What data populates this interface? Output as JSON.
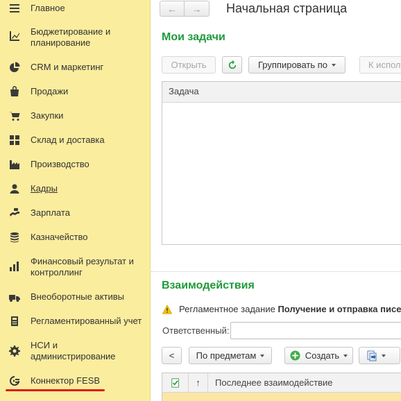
{
  "sidebar": {
    "items": [
      {
        "label": "Главное",
        "icon": "home-icon"
      },
      {
        "label": "Бюджетирование и планирование",
        "icon": "budget-chart-icon"
      },
      {
        "label": "CRM и маркетинг",
        "icon": "pie-chart-icon"
      },
      {
        "label": "Продажи",
        "icon": "shopping-bag-icon"
      },
      {
        "label": "Закупки",
        "icon": "cart-icon"
      },
      {
        "label": "Склад и доставка",
        "icon": "warehouse-grid-icon"
      },
      {
        "label": "Производство",
        "icon": "factory-icon"
      },
      {
        "label": "Кадры",
        "icon": "person-icon"
      },
      {
        "label": "Зарплата",
        "icon": "salary-icon"
      },
      {
        "label": "Казначейство",
        "icon": "coins-icon"
      },
      {
        "label": "Финансовый результат и контроллинг",
        "icon": "bar-chart-icon"
      },
      {
        "label": "Внеоборотные активы",
        "icon": "truck-icon"
      },
      {
        "label": "Регламентированный учет",
        "icon": "calculator-icon"
      },
      {
        "label": "НСИ и администрирование",
        "icon": "gear-icon"
      },
      {
        "label": "Коннектор FESB",
        "icon": "connector-icon"
      }
    ]
  },
  "header": {
    "back_label": "←",
    "forward_label": "→",
    "title": "Начальная страница"
  },
  "tasks": {
    "title": "Мои задачи",
    "open_label": "Открыть",
    "group_label": "Группировать по",
    "exec_label": "К испол",
    "column_task": "Задача"
  },
  "interactions": {
    "title": "Взаимодействия",
    "warning_prefix": "Регламентное задание ",
    "warning_bold": "Получение и отправка писе",
    "responsible_label": "Ответственный:",
    "responsible_value": "",
    "back_label": "<",
    "by_subject_label": "По предметам",
    "create_label": "Создать",
    "sort_label": "↑",
    "column_last": "Последнее взаимодействие"
  },
  "colors": {
    "sidebar_bg": "#fbed9e",
    "section_title": "#1f9a3a",
    "highlight_underline": "#e01b1b"
  }
}
